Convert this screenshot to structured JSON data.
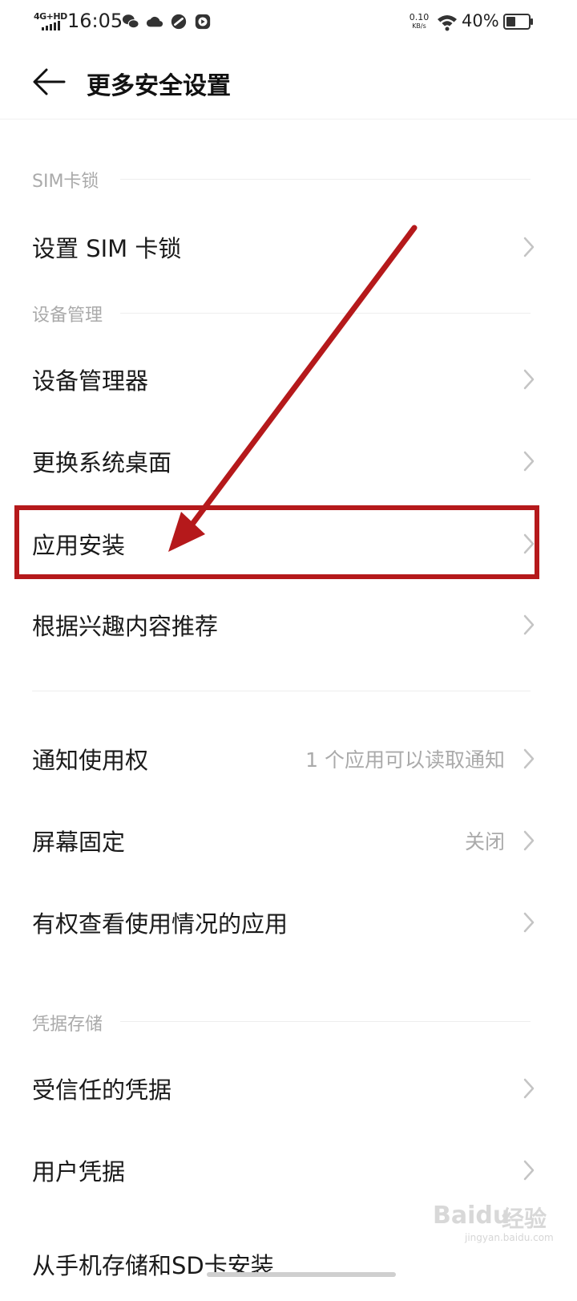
{
  "status_bar": {
    "network": "4G+HD",
    "time": "16:05",
    "net_speed_value": "0.10",
    "net_speed_unit": "KB/s",
    "battery_percent": "40%",
    "icons": [
      "wechat-icon",
      "cloud-icon",
      "link-icon",
      "record-icon",
      "wifi-icon",
      "battery-icon"
    ]
  },
  "header": {
    "back_icon": "back-arrow-icon",
    "title": "更多安全设置"
  },
  "sections": {
    "sim": {
      "title": "SIM卡锁"
    },
    "device": {
      "title": "设备管理"
    },
    "credentials": {
      "title": "凭据存储"
    }
  },
  "rows": [
    {
      "label": "设置 SIM 卡锁",
      "value": ""
    },
    {
      "label": "设备管理器",
      "value": ""
    },
    {
      "label": "更换系统桌面",
      "value": ""
    },
    {
      "label": "应用安装",
      "value": ""
    },
    {
      "label": "根据兴趣内容推荐",
      "value": ""
    },
    {
      "label": "通知使用权",
      "value": "1 个应用可以读取通知"
    },
    {
      "label": "屏幕固定",
      "value": "关闭"
    },
    {
      "label": "有权查看使用情况的应用",
      "value": ""
    },
    {
      "label": "受信任的凭据",
      "value": ""
    },
    {
      "label": "用户凭据",
      "value": ""
    },
    {
      "label": "从手机存储和SD卡安装",
      "value": ""
    }
  ],
  "annotation": {
    "highlight_color": "#b5191b",
    "highlighted_row": "应用安装"
  },
  "watermark": {
    "brand": "Baidu",
    "suffix": "经验",
    "url": "jingyan.baidu.com"
  },
  "colors": {
    "text_primary": "#1a1a1a",
    "text_secondary": "#aaaaaa",
    "background": "#ffffff"
  }
}
